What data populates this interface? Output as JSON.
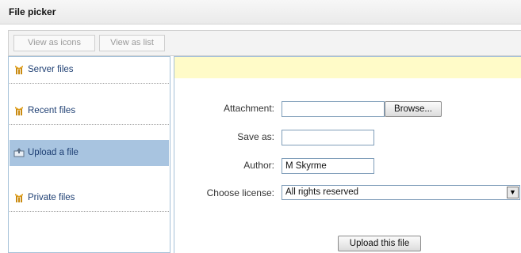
{
  "window": {
    "title": "File picker"
  },
  "toolbar": {
    "view_icons_label": "View as icons",
    "view_list_label": "View as list"
  },
  "sidebar": {
    "items": [
      {
        "label": "Server files",
        "icon": "repository-icon"
      },
      {
        "label": "Recent files",
        "icon": "repository-icon"
      },
      {
        "label": "Upload a file",
        "icon": "upload-icon",
        "active": true
      },
      {
        "label": "Private files",
        "icon": "repository-icon"
      }
    ]
  },
  "form": {
    "attachment_label": "Attachment:",
    "attachment_value": "",
    "browse_label": "Browse...",
    "save_as_label": "Save as:",
    "save_as_value": "",
    "author_label": "Author:",
    "author_value": "M Skyrme",
    "license_label": "Choose license:",
    "license_value": "All rights reserved",
    "upload_label": "Upload this file"
  },
  "colors": {
    "sidebar_active": "#a8c4e0",
    "notice_background": "#fffbc8",
    "link_text": "#1e3f73"
  }
}
